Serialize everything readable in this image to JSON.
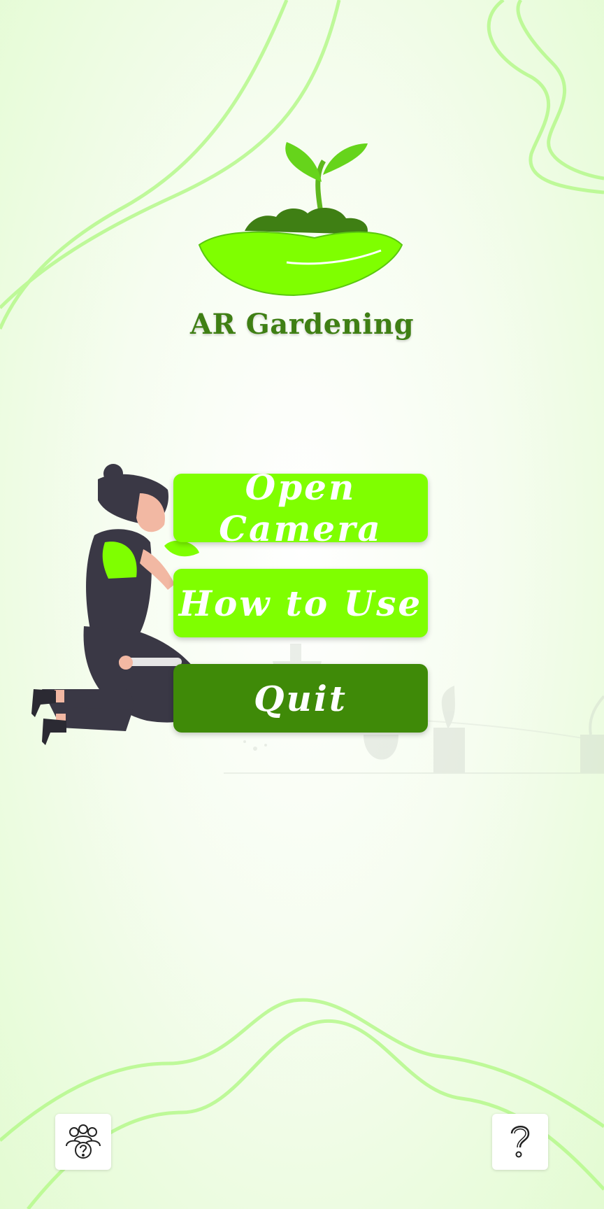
{
  "app": {
    "title": "AR Gardening"
  },
  "menu": {
    "open_camera_label": "Open Camera",
    "how_to_use_label": "How to Use",
    "quit_label": "Quit"
  },
  "footer": {
    "team_icon": "people-help-icon",
    "help_icon": "question-mark-icon"
  },
  "colors": {
    "primary_green": "#7fff00",
    "dark_green": "#3f8a08",
    "title_green": "#3f7f14"
  }
}
